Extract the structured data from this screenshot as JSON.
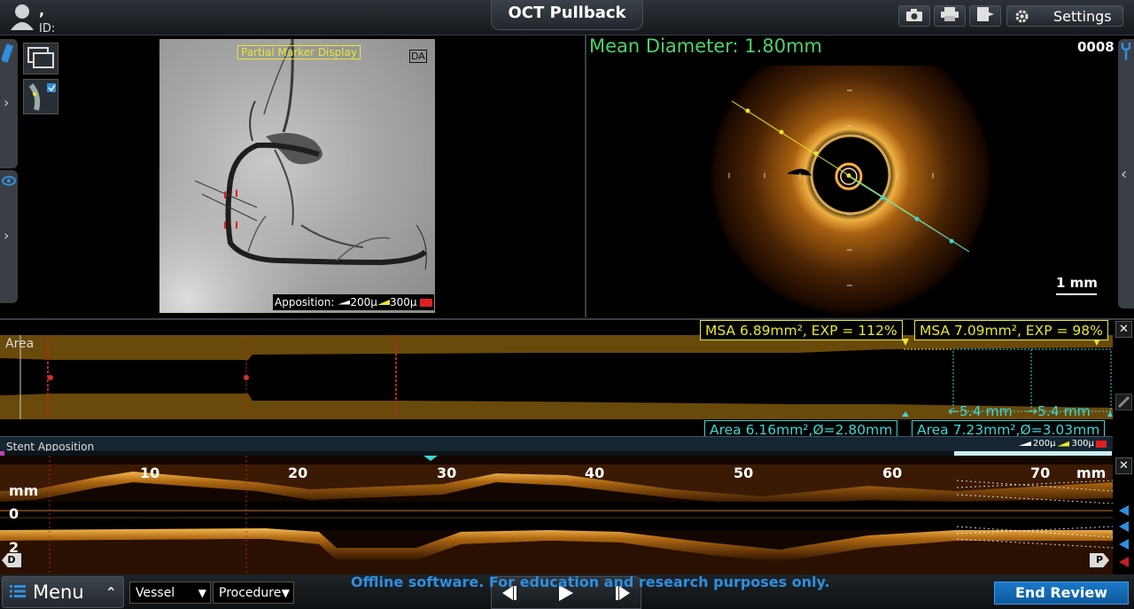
{
  "header": {
    "title": "OCT Pullback",
    "user_name": ",",
    "user_id": "ID:",
    "settings_label": "Settings",
    "icons": [
      "camera-icon",
      "printer-icon",
      "export-icon",
      "gear-icon"
    ]
  },
  "angio": {
    "overlay_label": "Partial Marker Display",
    "corner_label": "DA",
    "apposition_label": "Apposition:",
    "legend_200": "200µ",
    "legend_300": "300µ"
  },
  "cross_section": {
    "mean_diameter": "Mean Diameter:  1.80mm",
    "frame_number": "0008",
    "scale_label": "1 mm"
  },
  "area_panel": {
    "label": "Area",
    "msa_left": "MSA 6.89mm², EXP = 112%",
    "msa_right": "MSA 7.09mm², EXP = 98%",
    "length_left": "5.4 mm",
    "length_right": "5.4 mm",
    "area_left": "Area 6.16mm²,Ø=2.80mm",
    "area_right": "Area 7.23mm²,Ø=3.03mm"
  },
  "stent_apposition": {
    "label": "Stent Apposition",
    "legend_200": "200µ",
    "legend_300": "300µ"
  },
  "longitudinal": {
    "ticks": [
      "10",
      "20",
      "30",
      "40",
      "50",
      "60",
      "70"
    ],
    "unit": "mm",
    "y_unit": "mm",
    "y_zero": "0",
    "y_two": "2",
    "distal_marker": "D",
    "proximal_marker": "P"
  },
  "footer": {
    "menu_label": "Menu",
    "vessel_label": "Vessel",
    "procedure_label": "Procedure",
    "disclaimer": "Offline software. For education and research purposes only.",
    "end_review_label": "End Review"
  },
  "colors": {
    "accent_blue": "#1a78c8",
    "measure_yellow": "#e8e830",
    "measure_cyan": "#3ad6d6",
    "diameter_green": "#4cd36a"
  }
}
